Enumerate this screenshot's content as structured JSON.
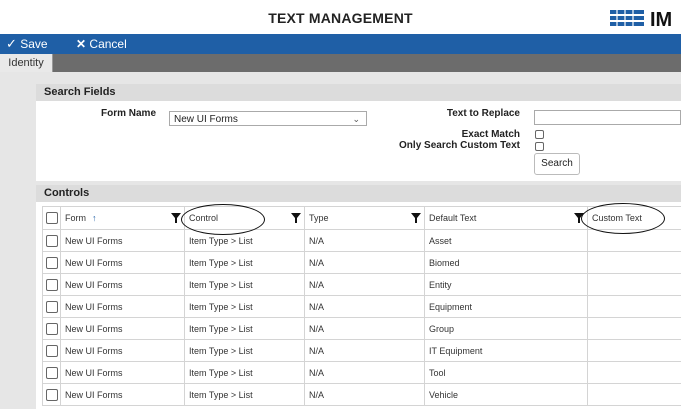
{
  "header": {
    "title": "TEXT MANAGEMENT",
    "logo_text": "IM"
  },
  "toolbar": {
    "save_label": "Save",
    "cancel_label": "Cancel"
  },
  "tabs": [
    {
      "label": "Identity"
    }
  ],
  "search": {
    "title": "Search Fields",
    "form_name_label": "Form Name",
    "form_name_value": "New UI Forms",
    "text_replace_label": "Text to Replace",
    "text_replace_value": "",
    "exact_match_label": "Exact Match",
    "exact_match_checked": false,
    "only_custom_label": "Only Search Custom Text",
    "only_custom_checked": false,
    "search_button": "Search"
  },
  "controls": {
    "title": "Controls",
    "columns": [
      "Form",
      "Control",
      "Type",
      "Default Text",
      "Custom Text"
    ],
    "rows": [
      [
        "New UI Forms",
        "Item Type > List",
        "N/A",
        "Asset",
        ""
      ],
      [
        "New UI Forms",
        "Item Type > List",
        "N/A",
        "Biomed",
        ""
      ],
      [
        "New UI Forms",
        "Item Type > List",
        "N/A",
        "Entity",
        ""
      ],
      [
        "New UI Forms",
        "Item Type > List",
        "N/A",
        "Equipment",
        ""
      ],
      [
        "New UI Forms",
        "Item Type > List",
        "N/A",
        "Group",
        ""
      ],
      [
        "New UI Forms",
        "Item Type > List",
        "N/A",
        "IT Equipment",
        ""
      ],
      [
        "New UI Forms",
        "Item Type > List",
        "N/A",
        "Tool",
        ""
      ],
      [
        "New UI Forms",
        "Item Type > List",
        "N/A",
        "Vehicle",
        ""
      ]
    ]
  },
  "colors": {
    "toolbar": "#1f5fa6",
    "tabbar": "#6c6c6c",
    "accent": "#1f5fa6"
  }
}
